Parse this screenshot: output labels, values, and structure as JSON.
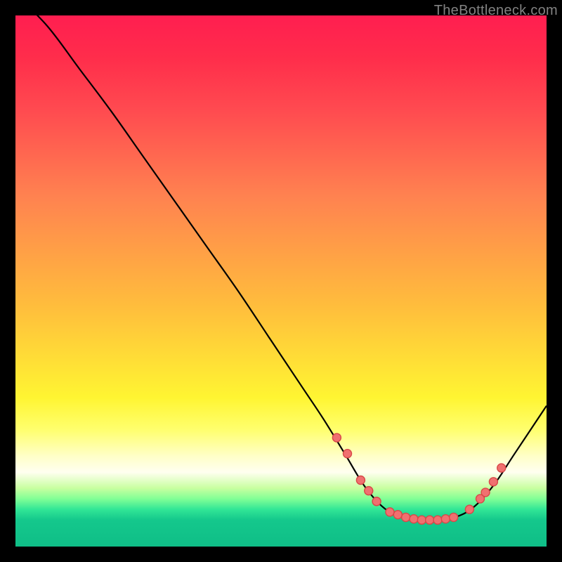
{
  "watermark": "TheBottleneck.com",
  "chart_data": {
    "type": "line",
    "title": "",
    "xlabel": "",
    "ylabel": "",
    "xlim": [
      0,
      100
    ],
    "ylim": [
      0,
      100
    ],
    "curve": [
      {
        "x": 0,
        "y": 104
      },
      {
        "x": 6,
        "y": 98
      },
      {
        "x": 12,
        "y": 90
      },
      {
        "x": 18,
        "y": 82
      },
      {
        "x": 24,
        "y": 73.5
      },
      {
        "x": 30,
        "y": 65
      },
      {
        "x": 36,
        "y": 56.5
      },
      {
        "x": 42,
        "y": 48
      },
      {
        "x": 48,
        "y": 39
      },
      {
        "x": 54,
        "y": 30
      },
      {
        "x": 58,
        "y": 24
      },
      {
        "x": 62,
        "y": 17.5
      },
      {
        "x": 66,
        "y": 11
      },
      {
        "x": 70,
        "y": 6.8
      },
      {
        "x": 74,
        "y": 5.2
      },
      {
        "x": 78,
        "y": 5
      },
      {
        "x": 82,
        "y": 5.3
      },
      {
        "x": 86,
        "y": 7.2
      },
      {
        "x": 90,
        "y": 11.5
      },
      {
        "x": 94,
        "y": 17.5
      },
      {
        "x": 100,
        "y": 26.5
      }
    ],
    "markers": [
      {
        "x": 60.5,
        "y": 20.5
      },
      {
        "x": 62.5,
        "y": 17.5
      },
      {
        "x": 65.0,
        "y": 12.5
      },
      {
        "x": 66.5,
        "y": 10.5
      },
      {
        "x": 68.0,
        "y": 8.5
      },
      {
        "x": 70.5,
        "y": 6.5
      },
      {
        "x": 72.0,
        "y": 6.0
      },
      {
        "x": 73.5,
        "y": 5.5
      },
      {
        "x": 75.0,
        "y": 5.2
      },
      {
        "x": 76.5,
        "y": 5.0
      },
      {
        "x": 78.0,
        "y": 5.0
      },
      {
        "x": 79.5,
        "y": 5.0
      },
      {
        "x": 81.0,
        "y": 5.2
      },
      {
        "x": 82.5,
        "y": 5.5
      },
      {
        "x": 85.5,
        "y": 7.0
      },
      {
        "x": 87.5,
        "y": 9.0
      },
      {
        "x": 88.5,
        "y": 10.2
      },
      {
        "x": 90.0,
        "y": 12.2
      },
      {
        "x": 91.5,
        "y": 14.8
      }
    ],
    "marker_style": {
      "fill": "#f07070",
      "stroke": "#d84848",
      "r": 6
    },
    "line_color": "#000000",
    "line_width": 2.2
  }
}
